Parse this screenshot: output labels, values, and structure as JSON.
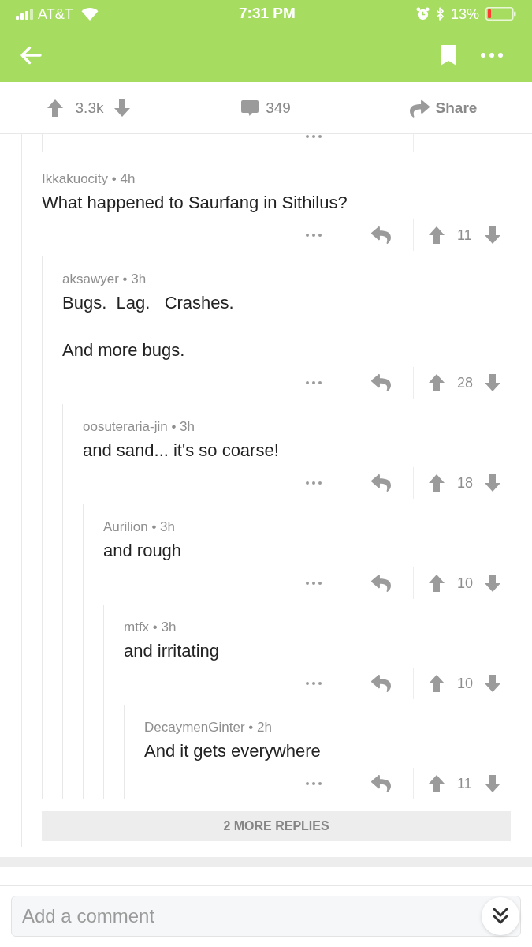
{
  "status_bar": {
    "carrier": "AT&T",
    "time": "7:31 PM",
    "battery": "13%"
  },
  "post_actions": {
    "score": "3.3k",
    "comment_count": "349",
    "share": "Share"
  },
  "comments": [
    {
      "byline": "Ikkakuocity • 4h",
      "body": [
        "What happened to Saurfang in Sithilus?"
      ],
      "score": "11",
      "children": [
        {
          "byline": "aksawyer • 3h",
          "body": [
            "Bugs.  Lag.   Crashes.",
            "And more bugs."
          ],
          "score": "28",
          "children": [
            {
              "byline": "oosuteraria-jin • 3h",
              "body": [
                "and sand... it's so coarse!"
              ],
              "score": "18",
              "children": [
                {
                  "byline": "Aurilion • 3h",
                  "body": [
                    "and rough"
                  ],
                  "score": "10",
                  "children": [
                    {
                      "byline": "mtfx • 3h",
                      "body": [
                        "and irritating"
                      ],
                      "score": "10",
                      "children": [
                        {
                          "byline": "DecaymenGinter • 2h",
                          "body": [
                            "And it gets everywhere"
                          ],
                          "score": "11"
                        }
                      ]
                    }
                  ]
                }
              ]
            }
          ]
        }
      ]
    }
  ],
  "more_replies": "2 MORE REPLIES",
  "comment_bar": {
    "placeholder": "Add a comment"
  }
}
